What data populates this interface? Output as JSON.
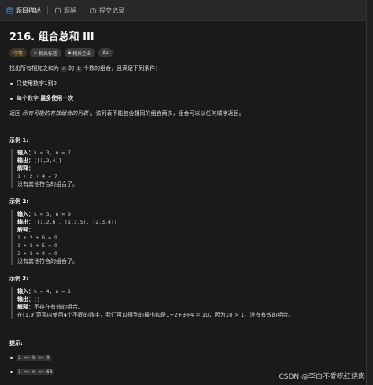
{
  "tabs": [
    {
      "label": "题目描述",
      "icon": "description-icon"
    },
    {
      "label": "题解",
      "icon": "solution-icon"
    },
    {
      "label": "提交记录",
      "icon": "history-icon"
    }
  ],
  "problem": {
    "title": "216. 组合总和 III",
    "badges": {
      "difficulty": "中等",
      "tags": "相关标签",
      "companies": "相关企业",
      "font": "Aa"
    },
    "intro_prefix": "找出所有相加之和为 ",
    "intro_n": "n",
    "intro_mid": " 的 ",
    "intro_k": "k",
    "intro_suffix": " 个数的组合，且满足下列条件：",
    "conditions": [
      "只使用数字1到9",
      "每个数字 最多使用一次"
    ],
    "return_text_prefix": "返回 ",
    "return_text_em": "所有可能的有效组合的列表",
    "return_text_suffix": " 。该列表不能包含相同的组合两次，组合可以以任何顺序返回。"
  },
  "examples": [
    {
      "title": "示例 1:",
      "input_label": "输入：",
      "input": "k = 3, n = 7",
      "output_label": "输出：",
      "output": "[[1,2,4]]",
      "explain_label": "解释：",
      "explain_lines": [
        "1 + 2 + 4 = 7",
        "没有其他符合的组合了。"
      ]
    },
    {
      "title": "示例 2:",
      "input_label": "输入：",
      "input": "k = 3, n = 9",
      "output_label": "输出：",
      "output": "[[1,2,6], [1,3,5], [2,3,4]]",
      "explain_label": "解释：",
      "explain_lines": [
        "1 + 2 + 6 = 9",
        "1 + 3 + 5 = 9",
        "2 + 3 + 4 = 9",
        "没有其他符合的组合了。"
      ]
    },
    {
      "title": "示例 3:",
      "input_label": "输入：",
      "input": "k = 4, n = 1",
      "output_label": "输出：",
      "output": "[]",
      "explain_label": "解释：",
      "explain_lines": [
        "不存在有效的组合。",
        "在[1,9]范围内使用4个不同的数字，我们可以得到的最小和是1+2+3+4 = 10，因为10 > 1，没有有效的组合。"
      ]
    }
  ],
  "hints": {
    "title": "提示:",
    "items": [
      "2 <= k <= 9",
      "1 <= n <= 60"
    ]
  },
  "watermark": "CSDN @李白不爱吃红烧肉"
}
